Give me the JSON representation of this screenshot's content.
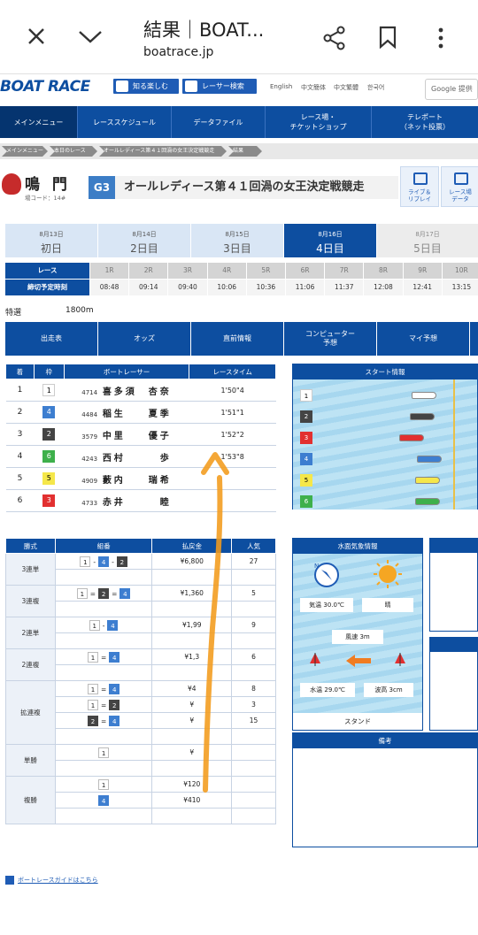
{
  "browser": {
    "title": "結果｜BOAT...",
    "url": "boatrace.jp"
  },
  "site": {
    "logo": "BOAT RACE",
    "top_buttons": [
      "知る楽しむ",
      "レーサー検索"
    ],
    "languages": [
      "English",
      "中文簡体",
      "中文繁體",
      "한국어"
    ],
    "search_label": "Google 提供"
  },
  "main_nav": [
    {
      "label": "メインメニュー"
    },
    {
      "label": "レーススケジュール"
    },
    {
      "label": "データファイル"
    },
    {
      "label": "レース場・\nチケットショップ"
    },
    {
      "label": "テレポート\n（ネット投票）"
    }
  ],
  "breadcrumb": [
    "メインメニュー",
    "本日のレース",
    "オールレディース第４１回渦の女王決定戦競走",
    "結果"
  ],
  "venue": {
    "name": "鳴 門",
    "code": "場コード：14#",
    "grade": "G3",
    "title": "オールレディース第４１回渦の女王決定戦競走",
    "live_label": "ライブ＆\nリプレイ",
    "data_label": "レース場\nデータ"
  },
  "days": [
    {
      "date": "8月13日",
      "label": "初日"
    },
    {
      "date": "8月14日",
      "label": "2日目"
    },
    {
      "date": "8月15日",
      "label": "3日目"
    },
    {
      "date": "8月16日",
      "label": "4日目"
    },
    {
      "date": "8月17日",
      "label": "5日目"
    }
  ],
  "race_grid": {
    "race_header": "レース",
    "time_header": "締切予定時刻",
    "races": [
      "1R",
      "2R",
      "3R",
      "4R",
      "5R",
      "6R",
      "7R",
      "8R",
      "9R",
      "10R"
    ],
    "times": [
      "08:48",
      "09:14",
      "09:40",
      "10:06",
      "10:36",
      "11:06",
      "11:37",
      "12:08",
      "12:41",
      "13:15"
    ]
  },
  "race_info": {
    "type": "特選",
    "distance": "1800m"
  },
  "tabs": [
    "出走表",
    "オッズ",
    "直前情報",
    "コンピューター\n予想",
    "マイ予想"
  ],
  "results": {
    "headers": [
      "着",
      "枠",
      "ボートレーサー",
      "レースタイム"
    ],
    "rows": [
      {
        "place": "1",
        "lane": "1",
        "regno": "4714",
        "name": "喜多須　杏奈",
        "time": "1'50\"4"
      },
      {
        "place": "2",
        "lane": "4",
        "regno": "4484",
        "name": "稲生　　夏季",
        "time": "1'51\"1"
      },
      {
        "place": "3",
        "lane": "2",
        "regno": "3579",
        "name": "中里　　優子",
        "time": "1'52\"2"
      },
      {
        "place": "4",
        "lane": "6",
        "regno": "4243",
        "name": "西村　　　歩",
        "time": "1'53\"8"
      },
      {
        "place": "5",
        "lane": "5",
        "regno": "4909",
        "name": "藪内　　瑞希",
        "time": ""
      },
      {
        "place": "6",
        "lane": "3",
        "regno": "4733",
        "name": "赤井　　　睦",
        "time": ""
      }
    ]
  },
  "start_info": {
    "header": "スタート情報",
    "lanes": [
      "1",
      "2",
      "3",
      "4",
      "5",
      "6"
    ]
  },
  "payout": {
    "headers": [
      "勝式",
      "組番",
      "払戻金",
      "人気"
    ],
    "groups": [
      {
        "type": "3連単",
        "rows": [
          {
            "combo": [
              "1",
              "-",
              "4",
              "-",
              "2"
            ],
            "amount": "¥6,800",
            "pop": "27"
          }
        ]
      },
      {
        "type": "3連複",
        "rows": [
          {
            "combo": [
              "1",
              "=",
              "2",
              "=",
              "4"
            ],
            "amount": "¥1,360",
            "pop": "5"
          }
        ]
      },
      {
        "type": "2連単",
        "rows": [
          {
            "combo": [
              "1",
              "-",
              "4"
            ],
            "amount": "¥1,99",
            "pop": "9"
          }
        ]
      },
      {
        "type": "2連複",
        "rows": [
          {
            "combo": [
              "1",
              "=",
              "4"
            ],
            "amount": "¥1,3",
            "pop": "6"
          }
        ]
      },
      {
        "type": "拡連複",
        "rows": [
          {
            "combo": [
              "1",
              "=",
              "4"
            ],
            "amount": "¥4",
            "pop": "8"
          },
          {
            "combo": [
              "1",
              "=",
              "2"
            ],
            "amount": "¥",
            "pop": "3"
          },
          {
            "combo": [
              "2",
              "=",
              "4"
            ],
            "amount": "¥",
            "pop": "15"
          }
        ]
      },
      {
        "type": "単勝",
        "rows": [
          {
            "combo": [
              "1"
            ],
            "amount": "¥",
            "pop": ""
          }
        ]
      },
      {
        "type": "複勝",
        "rows": [
          {
            "combo": [
              "1"
            ],
            "amount": "¥120",
            "pop": ""
          },
          {
            "combo": [
              "4"
            ],
            "amount": "¥410",
            "pop": ""
          }
        ]
      }
    ]
  },
  "weather": {
    "header": "水面気象情報",
    "temp": "気温 30.0℃",
    "sky": "晴",
    "wind": "風速 3m",
    "water_temp": "水温 29.0℃",
    "wave": "波高 3cm",
    "stand": "スタンド",
    "compass": "N"
  },
  "notes": {
    "header": "備考"
  },
  "guide_link": "ボートレースガイドはこちら",
  "colors": {
    "brand": "#0d4ea0",
    "lane1": "#ffffff",
    "lane2": "#444444",
    "lane3": "#e23030",
    "lane4": "#3d7ed0",
    "lane5": "#f5e74a",
    "lane6": "#3eb04b",
    "annotation": "#f29b1b"
  }
}
